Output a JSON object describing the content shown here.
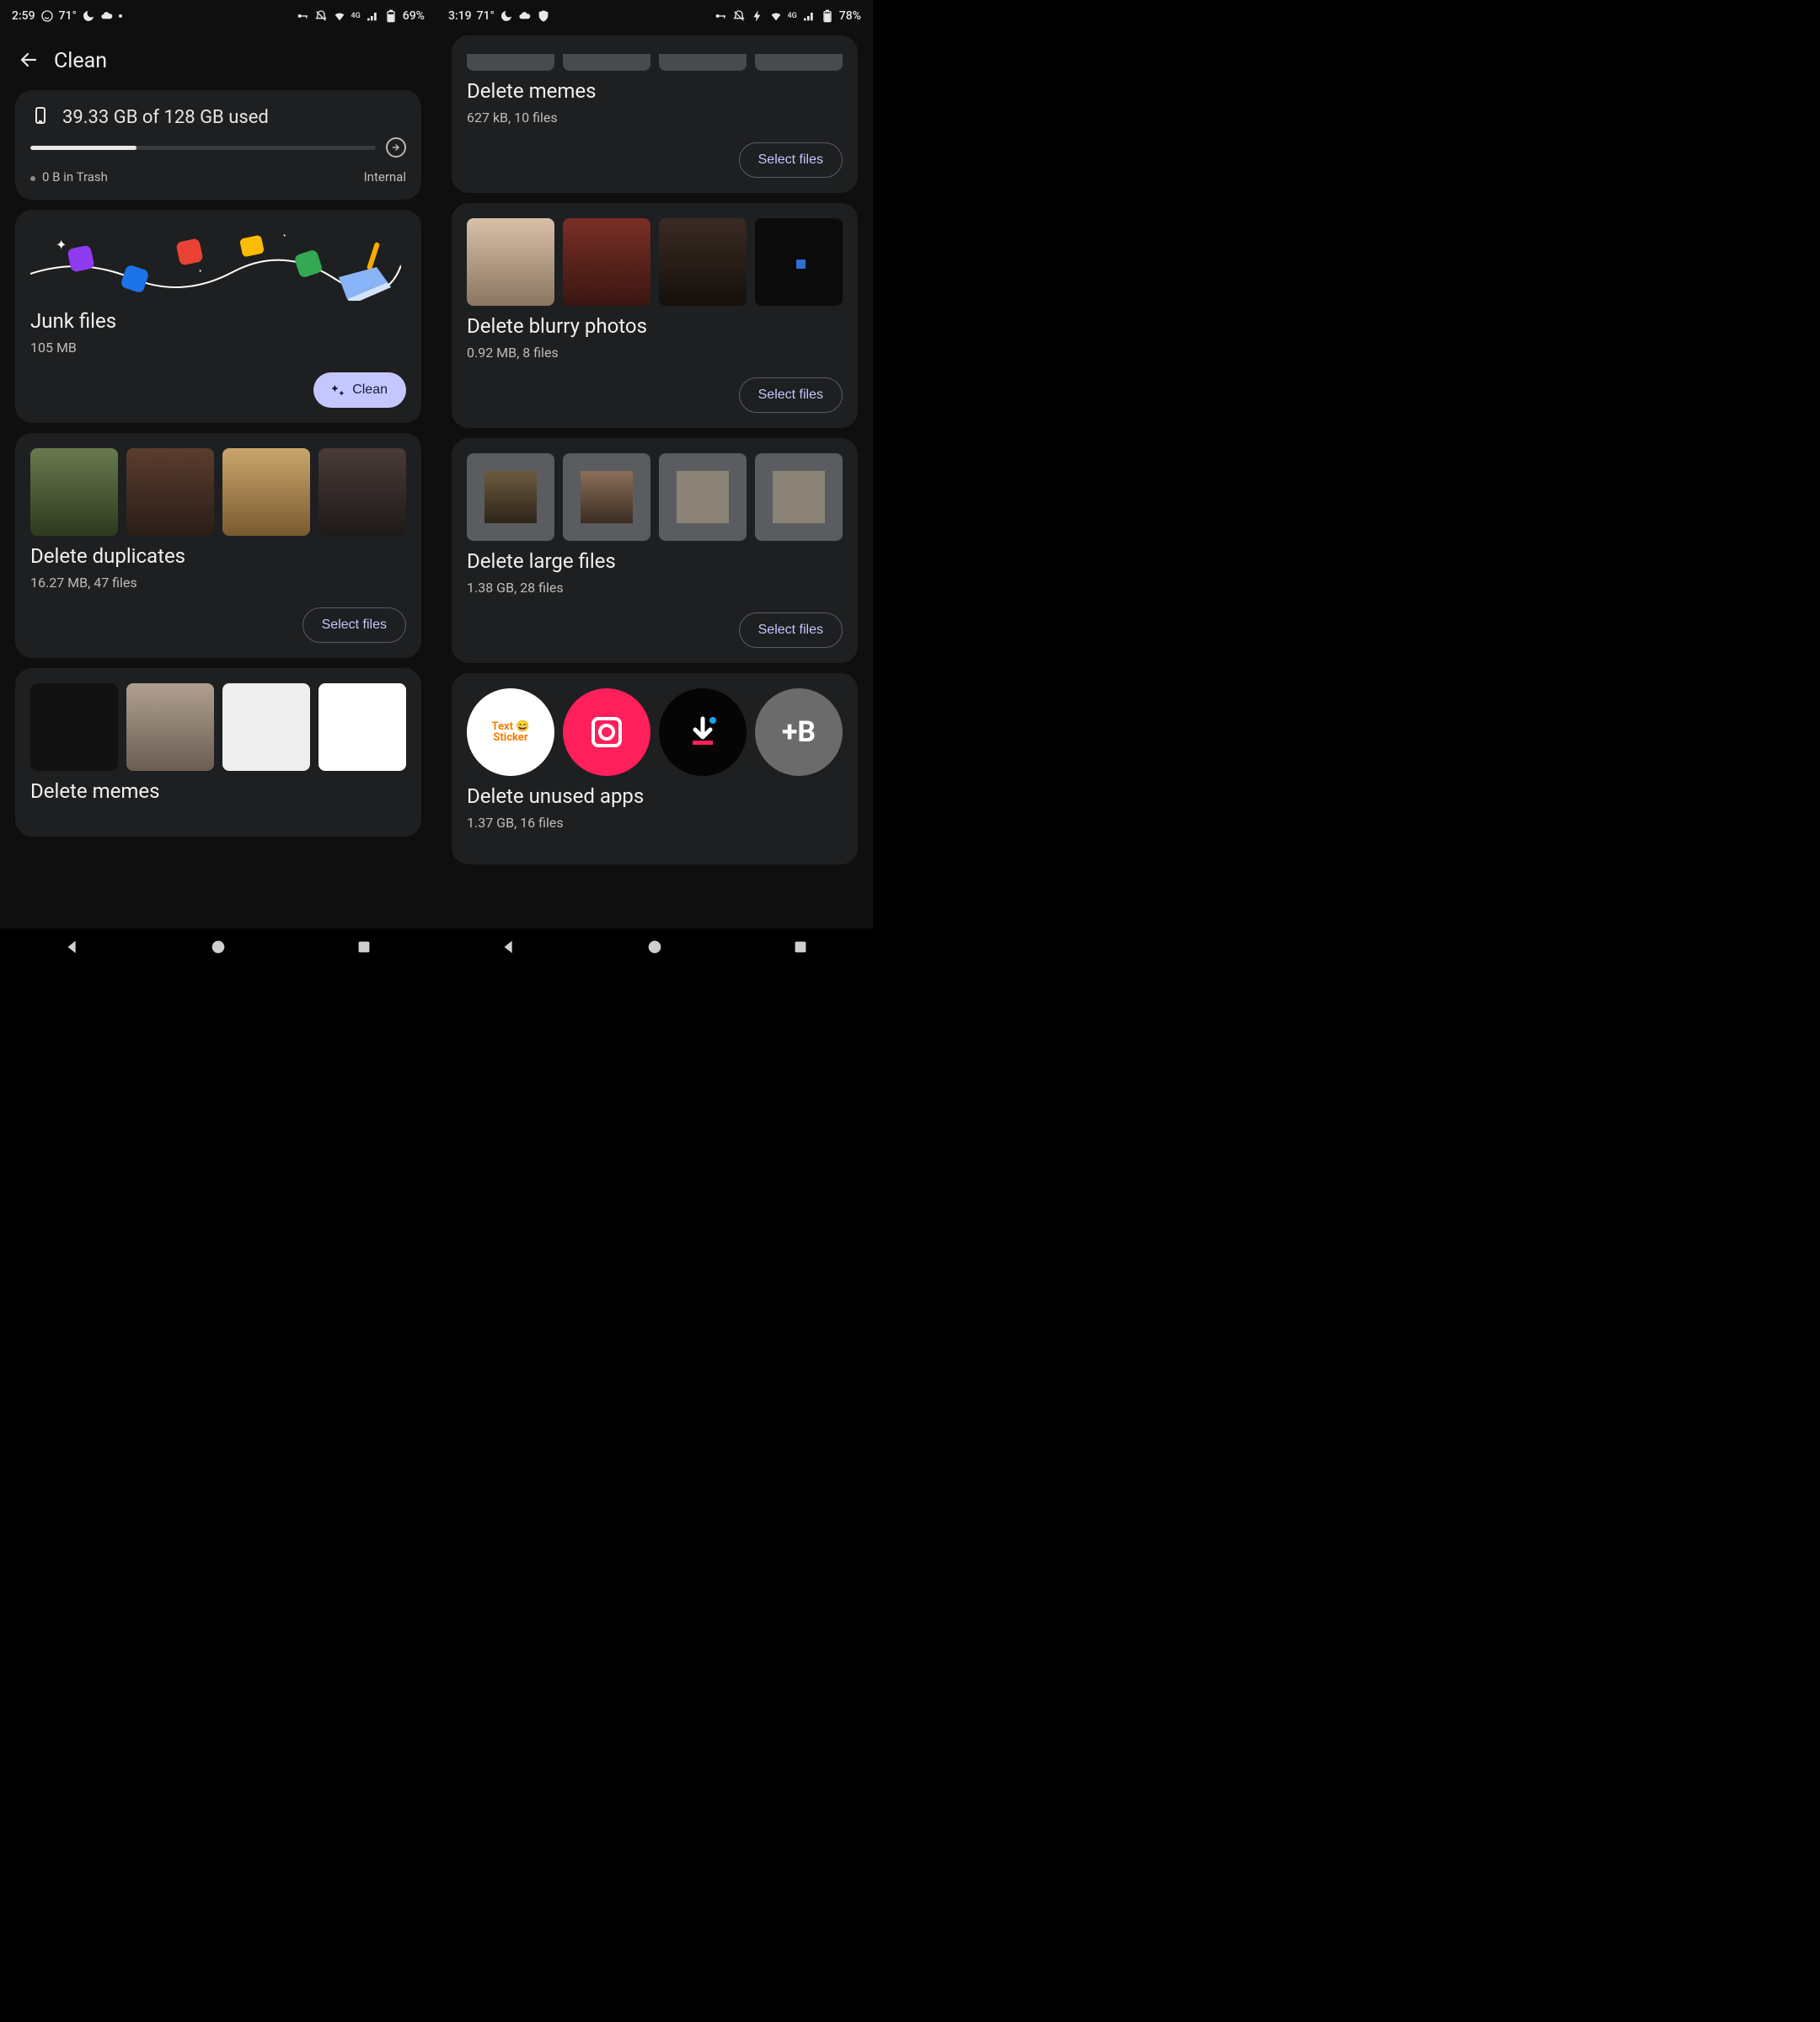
{
  "phoneA": {
    "status": {
      "time": "2:59",
      "temp": "71°",
      "battery": "69%",
      "net": "4G"
    },
    "header": {
      "title": "Clean"
    },
    "storage": {
      "used_line": "39.33 GB of 128 GB used",
      "trash": "0 B in Trash",
      "location": "Internal",
      "percent": 30.7
    },
    "junk": {
      "title": "Junk files",
      "size": "105 MB",
      "button": "Clean"
    },
    "duplicates": {
      "title": "Delete duplicates",
      "sub": "16.27 MB, 47 files",
      "button": "Select files"
    },
    "memes_teaser": {
      "title": "Delete memes"
    }
  },
  "phoneB": {
    "status": {
      "time": "3:19",
      "temp": "71°",
      "battery": "78%",
      "net": "4G"
    },
    "memes": {
      "title": "Delete memes",
      "sub": "627 kB, 10 files",
      "button": "Select files"
    },
    "blurry": {
      "title": "Delete blurry photos",
      "sub": "0.92 MB, 8 files",
      "button": "Select files"
    },
    "large": {
      "title": "Delete large files",
      "sub": "1.38 GB, 28 files",
      "button": "Select files"
    },
    "unused": {
      "title": "Delete unused apps",
      "sub": "1.37 GB, 16 files"
    }
  },
  "icons": {
    "back": "back-arrow",
    "phone": "device",
    "expand": "arrow-circle-right"
  }
}
